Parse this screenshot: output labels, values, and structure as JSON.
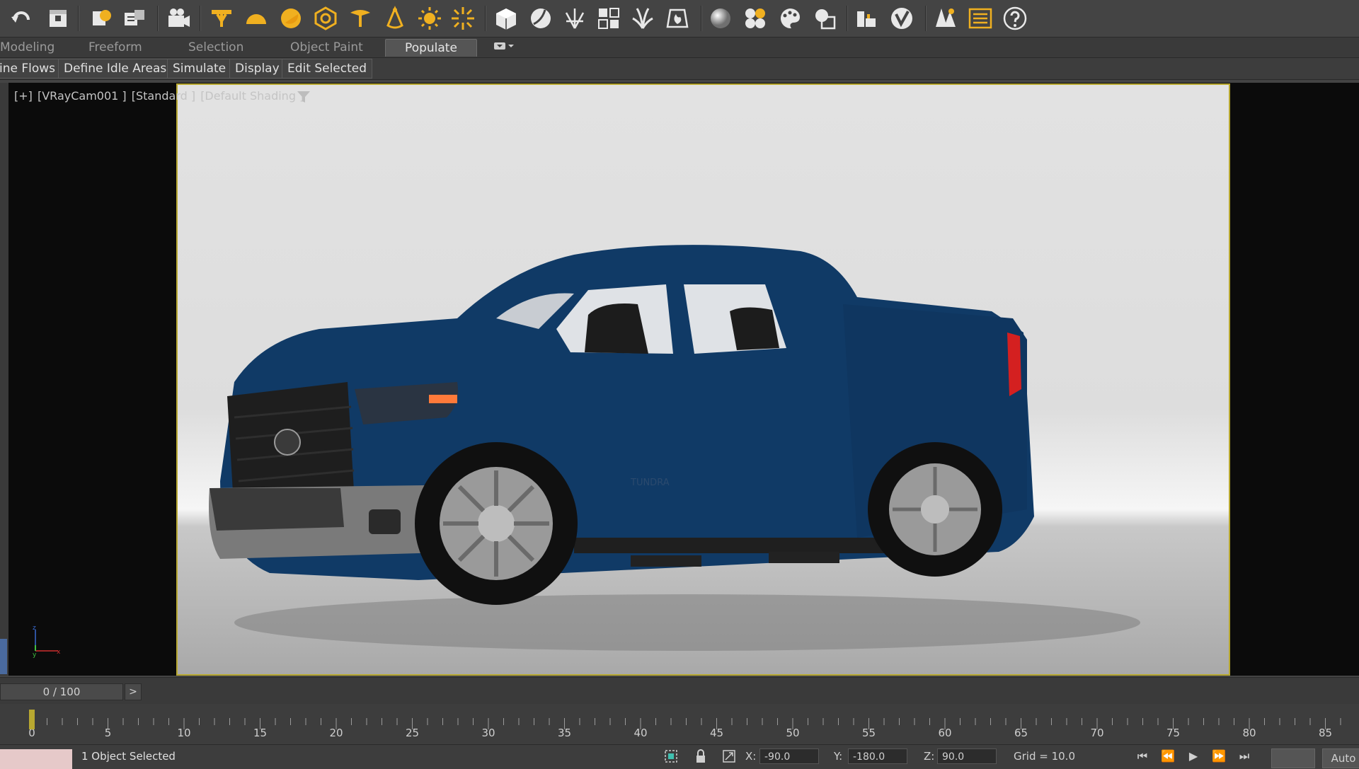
{
  "toolbar": {
    "icons": [
      "undo-icon",
      "open-scene-icon",
      "helper-icon",
      "light-lister-icon",
      "camera-icon",
      "omni-light-icon",
      "sky-light-icon",
      "sun-light-icon",
      "dome-light-icon",
      "spot-light-icon",
      "ies-light-icon",
      "sun-icon",
      "sparkle-light-icon",
      "vray-cube-icon",
      "vray-sphere-icon",
      "fur-icon",
      "proxy-icon",
      "grass-icon",
      "fire-icon",
      "material-sphere-icon",
      "material-browser-icon",
      "palette-icon",
      "scene-converter-icon",
      "frame-buffer-icon",
      "vray-logo-icon",
      "forest-icon",
      "menu-icon",
      "help-icon"
    ]
  },
  "ribbon": {
    "tabs": [
      "Modeling",
      "Freeform",
      "Selection",
      "Object Paint",
      "Populate"
    ],
    "active_tab": "Populate",
    "buttons": [
      "ine Flows",
      "Define Idle Areas",
      "Simulate",
      "Display",
      "Edit Selected"
    ]
  },
  "viewport": {
    "label_parts": [
      "[+]",
      "[VRayCam001 ]",
      "[Standard ]",
      "[Default Shading ]"
    ],
    "vehicle_badge": "TUNDRA"
  },
  "timeline": {
    "frame_display": "0 / 100",
    "next_label": ">",
    "tick_labels": [
      "0",
      "5",
      "10",
      "15",
      "20",
      "25",
      "30",
      "35",
      "40",
      "45",
      "50",
      "55",
      "60",
      "65",
      "70",
      "75",
      "80",
      "85"
    ]
  },
  "status": {
    "selection_text": "1 Object Selected",
    "x_label": "X:",
    "x_value": "-90.0",
    "y_label": "Y:",
    "y_value": "-180.0",
    "z_label": "Z:",
    "z_value": "90.0",
    "grid_text": "Grid = 10.0",
    "auto_label": "Auto"
  },
  "colors": {
    "accent_yellow": "#b8a830",
    "truck_blue": "#103a66",
    "status_swatch": "#e6c9c9"
  }
}
